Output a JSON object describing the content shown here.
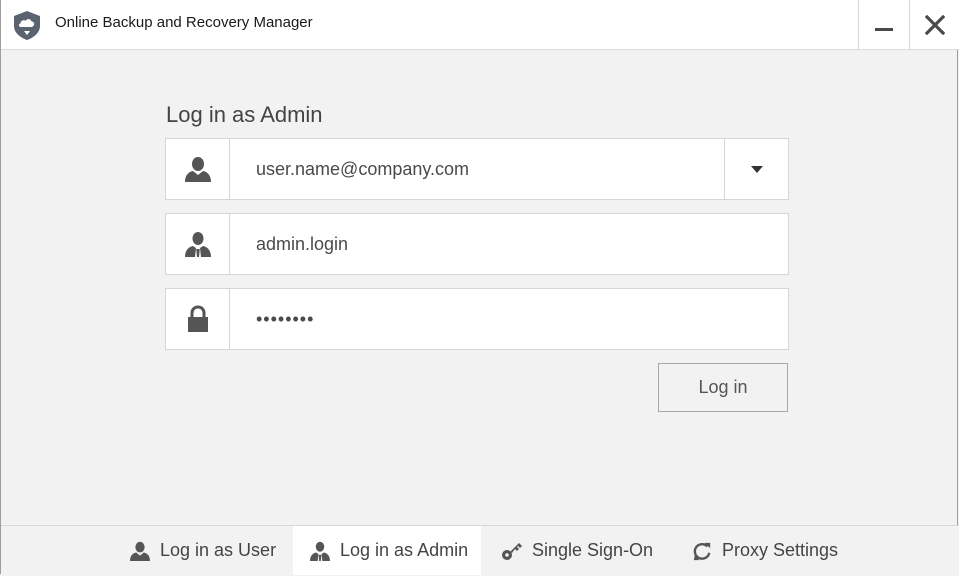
{
  "window": {
    "title": "Online Backup and Recovery Manager"
  },
  "form": {
    "heading": "Log in as Admin",
    "email": {
      "value": "user.name@company.com"
    },
    "admin_login": {
      "value": "admin.login"
    },
    "password": {
      "value": "••••••••"
    },
    "login_button": "Log in"
  },
  "tabs": [
    {
      "label": "Log in as User",
      "icon": "user-icon",
      "active": false
    },
    {
      "label": "Log in as Admin",
      "icon": "admin-icon",
      "active": true
    },
    {
      "label": "Single Sign-On",
      "icon": "key-icon",
      "active": false
    },
    {
      "label": "Proxy Settings",
      "icon": "refresh-icon",
      "active": false
    }
  ],
  "colors": {
    "icon": "#555555",
    "background": "#f2f2f2",
    "active_tab": "#ffffff"
  }
}
